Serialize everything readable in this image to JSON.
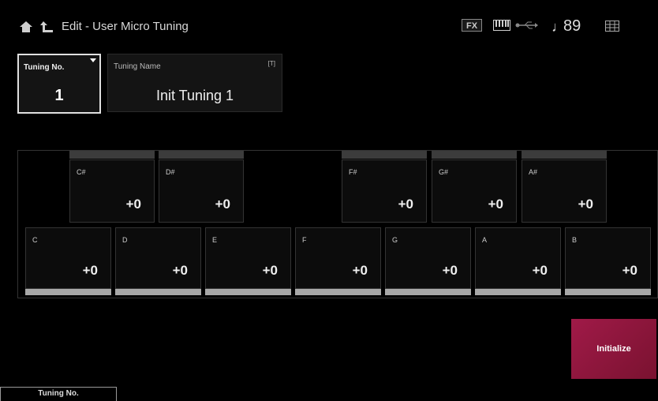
{
  "header": {
    "title": "Edit - User Micro Tuning",
    "fx_label": "FX",
    "tempo": "89",
    "note_symbol": "♩"
  },
  "tuning_no": {
    "label": "Tuning No.",
    "value": "1"
  },
  "tuning_name": {
    "label": "Tuning Name",
    "keyboard_hint": "[T]",
    "value": "Init Tuning 1"
  },
  "black_keys": [
    {
      "name": "C#",
      "value": "+0"
    },
    {
      "name": "D#",
      "value": "+0"
    },
    {
      "name": "F#",
      "value": "+0"
    },
    {
      "name": "G#",
      "value": "+0"
    },
    {
      "name": "A#",
      "value": "+0"
    }
  ],
  "white_keys": [
    {
      "name": "C",
      "value": "+0"
    },
    {
      "name": "D",
      "value": "+0"
    },
    {
      "name": "E",
      "value": "+0"
    },
    {
      "name": "F",
      "value": "+0"
    },
    {
      "name": "G",
      "value": "+0"
    },
    {
      "name": "A",
      "value": "+0"
    },
    {
      "name": "B",
      "value": "+0"
    }
  ],
  "initialize_label": "Initialize",
  "footer_tab_label": "Tuning No.",
  "colors": {
    "accent": "#a01a48",
    "background": "#000000"
  }
}
